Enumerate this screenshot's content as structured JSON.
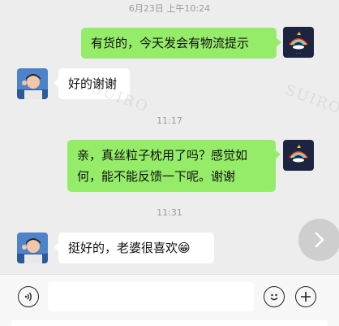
{
  "chat": {
    "timestamps": [
      "6月23日 上午10:24",
      "11:17",
      "11:31"
    ],
    "messages": [
      {
        "from": "me",
        "text": "有货的，今天发会有物流提示"
      },
      {
        "from": "other",
        "text": "好的谢谢"
      },
      {
        "from": "me",
        "text_line1": "亲，真丝粒子枕用了吗？感觉如",
        "text_line2": "何，能不能反馈一下呢。谢谢"
      },
      {
        "from": "other",
        "text": "挺好的，老婆很喜欢",
        "emoji": "😁"
      }
    ],
    "watermark": "SUIRO"
  },
  "input_bar": {
    "voice_icon": "voice-icon",
    "emoji_icon": "smiley-icon",
    "plus_icon": "plus-icon",
    "text_value": ""
  },
  "colors": {
    "sent_bubble": "#95ec69",
    "received_bubble": "#ffffff",
    "background": "#ededed"
  }
}
